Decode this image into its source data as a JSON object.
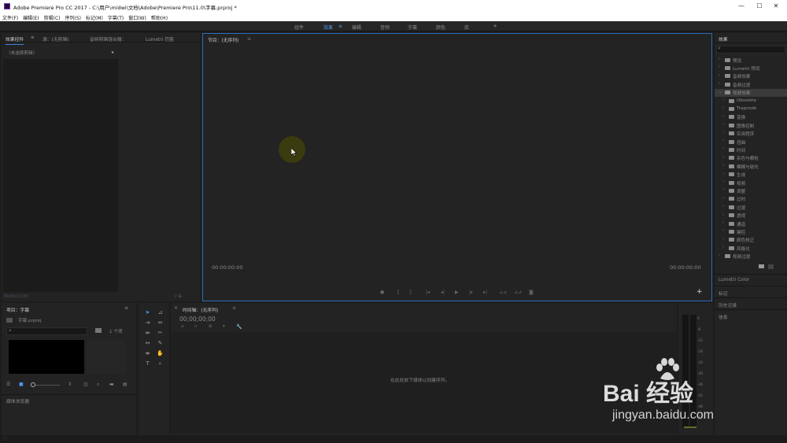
{
  "window": {
    "title": "Adobe Premiere Pro CC 2017 - C:\\用户\\midwi\\文档\\Adobe\\Premiere Pro\\11.0\\字幕.prproj *",
    "minimize": "—",
    "maximize": "☐",
    "close": "✕"
  },
  "menu": [
    "文件(F)",
    "编辑(E)",
    "剪辑(C)",
    "序列(S)",
    "标记(M)",
    "字幕(T)",
    "窗口(W)",
    "帮助(H)"
  ],
  "workspaces": [
    "组件",
    "效果",
    "编辑",
    "音频",
    "字幕",
    "颜色",
    "库"
  ],
  "workspace_active": "效果",
  "workspace_more": "»",
  "effect_controls": {
    "tabs": [
      "效果控件",
      "源：(无剪辑)",
      "音频剪辑混合器：",
      "Lumetri 范围"
    ],
    "no_clip": "（未选择剪辑）",
    "timecode": "00;00;11;00"
  },
  "program": {
    "title": "节目：(无序列)",
    "timecode_left": "00:00:00:00",
    "timecode_right": "00:00:00:00",
    "add": "+"
  },
  "project": {
    "title": "项目：字幕",
    "file": "字幕.prproj",
    "search_placeholder": "",
    "item_count": "1 个项",
    "media_browser": "媒体浏览器"
  },
  "timeline": {
    "title": "时间轴：(无序列)",
    "timecode": "00;00;00;00",
    "drop_hint": "在此处放下媒体以创建序列。"
  },
  "effects_panel": {
    "title": "效果",
    "items": [
      {
        "label": "预设",
        "level": 0,
        "open": false,
        "selected": false
      },
      {
        "label": "Lumetri 预设",
        "level": 0,
        "open": false,
        "selected": false
      },
      {
        "label": "音频效果",
        "level": 0,
        "open": false,
        "selected": false
      },
      {
        "label": "音频过渡",
        "level": 0,
        "open": false,
        "selected": false
      },
      {
        "label": "视频效果",
        "level": 0,
        "open": true,
        "selected": true
      },
      {
        "label": "Obsolete",
        "level": 1,
        "open": false,
        "selected": false
      },
      {
        "label": "Trapcode",
        "level": 1,
        "open": false,
        "selected": false
      },
      {
        "label": "变换",
        "level": 1,
        "open": false,
        "selected": false
      },
      {
        "label": "图像控制",
        "level": 1,
        "open": false,
        "selected": false
      },
      {
        "label": "实用程序",
        "level": 1,
        "open": false,
        "selected": false
      },
      {
        "label": "扭曲",
        "level": 1,
        "open": false,
        "selected": false
      },
      {
        "label": "时间",
        "level": 1,
        "open": false,
        "selected": false
      },
      {
        "label": "杂色与颗粒",
        "level": 1,
        "open": false,
        "selected": false
      },
      {
        "label": "模糊与锐化",
        "level": 1,
        "open": false,
        "selected": false
      },
      {
        "label": "生成",
        "level": 1,
        "open": false,
        "selected": false
      },
      {
        "label": "视频",
        "level": 1,
        "open": false,
        "selected": false
      },
      {
        "label": "调整",
        "level": 1,
        "open": false,
        "selected": false
      },
      {
        "label": "过时",
        "level": 1,
        "open": false,
        "selected": false
      },
      {
        "label": "过渡",
        "level": 1,
        "open": false,
        "selected": false
      },
      {
        "label": "透视",
        "level": 1,
        "open": false,
        "selected": false
      },
      {
        "label": "通道",
        "level": 1,
        "open": false,
        "selected": false
      },
      {
        "label": "键控",
        "level": 1,
        "open": false,
        "selected": false
      },
      {
        "label": "颜色校正",
        "level": 1,
        "open": false,
        "selected": false
      },
      {
        "label": "风格化",
        "level": 1,
        "open": false,
        "selected": false
      },
      {
        "label": "视频过渡",
        "level": 0,
        "open": false,
        "selected": false
      }
    ],
    "sections": [
      "Lumetri Color",
      "标记",
      "历史记录",
      "信息"
    ]
  },
  "audio_meter": {
    "labels": [
      "0",
      "-6",
      "-12",
      "-18",
      "-24",
      "-30",
      "-36",
      "-42",
      "-48",
      "-54"
    ]
  },
  "watermark": {
    "brand": "Bai 经验",
    "url": "jingyan.baidu.com"
  }
}
